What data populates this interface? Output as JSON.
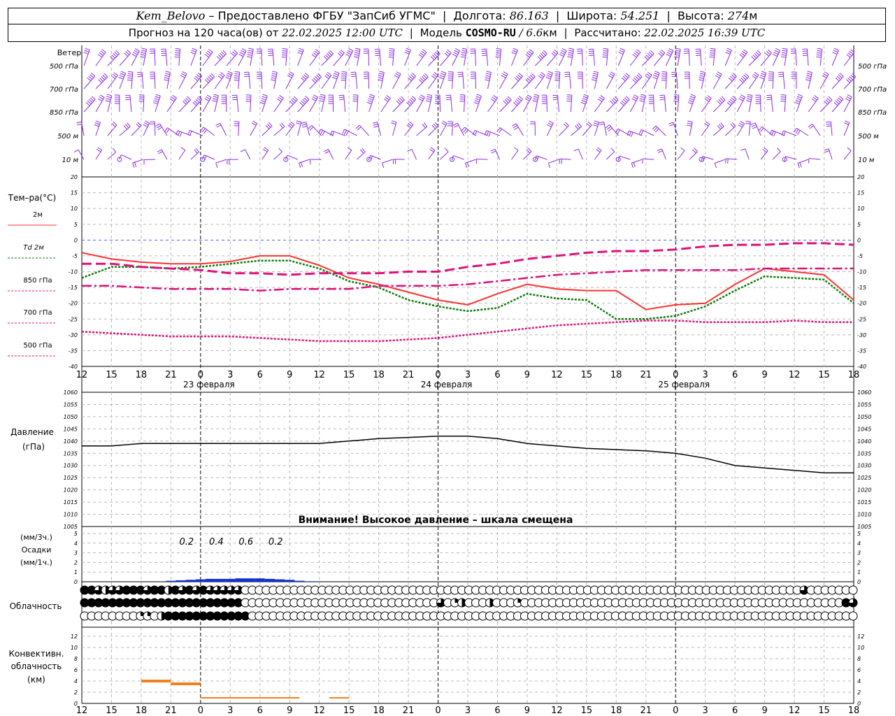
{
  "header": {
    "station": "Kem_Belovo",
    "provided_by": "– Предоставлено ФГБУ \"ЗапСиб УГМС\"",
    "lon_label": "Долгота:",
    "lon_value": "86.163",
    "lat_label": "Широта:",
    "lat_value": "54.251",
    "alt_label": "Высота:",
    "alt_value": "274",
    "alt_unit": "м",
    "forecast_prefix": "Прогноз на 120 часа(ов) от",
    "forecast_start": "22.02.2025 12:00 UTC",
    "model_label": "Модель",
    "model_name": "COSMO-RU",
    "model_res": "/ 6.6",
    "model_res_unit": "км",
    "calc_label": "Рассчитано:",
    "calc_time": "22.02.2025 16:39 UTC"
  },
  "time_axis": {
    "hour_labels": [
      "12",
      "15",
      "18",
      "21",
      "0",
      "3",
      "6",
      "9",
      "12",
      "15",
      "18",
      "21",
      "0",
      "3",
      "6",
      "9",
      "12",
      "15",
      "18",
      "21",
      "0",
      "3",
      "6",
      "9",
      "12",
      "15",
      "18"
    ],
    "day_labels": [
      "23 февраля",
      "24 февраля",
      "25 февраля"
    ]
  },
  "chart_data": [
    {
      "type": "wind_barbs",
      "title": "Ветер",
      "levels": [
        "500 гПа",
        "700 гПа",
        "850 гПа",
        "500 м",
        "10 м"
      ],
      "color": "#8a2be2"
    },
    {
      "type": "line",
      "ylabel": "Тем–ра(°С)",
      "ylim": [
        -40,
        20
      ],
      "yticks": [
        20,
        15,
        10,
        5,
        0,
        -5,
        -10,
        -15,
        -20,
        -25,
        -30,
        -35,
        -40
      ],
      "x_hours": [
        0,
        3,
        6,
        9,
        12,
        15,
        18,
        21,
        24,
        27,
        30,
        33,
        36,
        39,
        42,
        45,
        48,
        51,
        54,
        57,
        60,
        63,
        66,
        69,
        72,
        75,
        78
      ],
      "series": [
        {
          "name": "2м",
          "color": "#ff3030",
          "style": "solid",
          "values": [
            -4,
            -6,
            -7,
            -7.5,
            -7.5,
            -6.8,
            -5,
            -5,
            -8,
            -12,
            -14,
            -16.5,
            -19,
            -20.5,
            -17,
            -14,
            -15.5,
            -16,
            -16,
            -22,
            -20.5,
            -20,
            -14,
            -9,
            -10,
            -11,
            -19
          ]
        },
        {
          "name": "Td 2м",
          "color": "#0a7a0a",
          "style": "dotted",
          "values": [
            -12,
            -8.5,
            -8.5,
            -9,
            -8.5,
            -7.5,
            -6.5,
            -6.5,
            -9,
            -13,
            -15,
            -19,
            -21,
            -22.5,
            -21.5,
            -17,
            -18.5,
            -19,
            -25,
            -25,
            -24,
            -21,
            -16,
            -11.5,
            -12,
            -12.5,
            -20
          ]
        },
        {
          "name": "850 гПа",
          "color": "#e0107a",
          "style": "longdash",
          "values": [
            -7.5,
            -7.5,
            -8.5,
            -9,
            -9.5,
            -10.5,
            -10.5,
            -11,
            -10.5,
            -10.5,
            -10.5,
            -10,
            -10,
            -8.5,
            -7.5,
            -6,
            -5,
            -4,
            -3.5,
            -3.5,
            -3,
            -2,
            -1.5,
            -1.5,
            -1,
            -1,
            -1.5
          ]
        },
        {
          "name": "700 гПа",
          "color": "#e0107a",
          "style": "dashdot",
          "values": [
            -14.5,
            -14.5,
            -15,
            -15.5,
            -15.5,
            -15.5,
            -16,
            -15.5,
            -15.5,
            -15.5,
            -14.5,
            -14.5,
            -14.5,
            -14,
            -13,
            -12,
            -11,
            -10.5,
            -10,
            -9.5,
            -9.5,
            -9.5,
            -9.5,
            -9,
            -9,
            -9,
            -9
          ]
        },
        {
          "name": "500 гПа",
          "color": "#e0107a",
          "style": "dense",
          "values": [
            -29,
            -29.5,
            -30,
            -30.5,
            -30.5,
            -30.5,
            -31,
            -31.5,
            -32,
            -32,
            -32,
            -31.5,
            -31,
            -30,
            -29,
            -28,
            -27,
            -26.5,
            -26,
            -25.5,
            -25.5,
            -26,
            -26,
            -26,
            -25.5,
            -26,
            -26
          ]
        }
      ]
    },
    {
      "type": "line",
      "ylabel": "Давление",
      "yunit": "(гПа)",
      "ylim": [
        1005,
        1060
      ],
      "yticks": [
        1060,
        1055,
        1050,
        1045,
        1040,
        1035,
        1030,
        1025,
        1020,
        1015,
        1010,
        1005
      ],
      "annotation": "Внимание! Высокое давление – шкала смещена",
      "series": [
        {
          "name": "",
          "color": "#000000",
          "values": [
            1038,
            1038,
            1039,
            1039,
            1039,
            1039,
            1039,
            1039,
            1039,
            1040,
            1041,
            1041.5,
            1042,
            1042,
            1041,
            1039,
            1038,
            1037,
            1036.5,
            1036,
            1035,
            1033,
            1030,
            1029,
            1028,
            1027,
            1027
          ]
        }
      ]
    },
    {
      "type": "bar",
      "ylabel": "Осадки",
      "yunit_top": "(мм/3ч.)",
      "yunit_bottom": "(мм/1ч.)",
      "ylim": [
        0,
        5
      ],
      "yticks": [
        5,
        4,
        3,
        2,
        1,
        0
      ],
      "color": "#1030d0",
      "labels": [
        "0.2",
        "0.4",
        "0.6",
        "0.2"
      ],
      "label_hours": [
        12,
        15,
        18,
        21
      ],
      "hourly": [
        [
          9,
          0.1
        ],
        [
          10,
          0.15
        ],
        [
          11,
          0.2
        ],
        [
          12,
          0.25
        ],
        [
          13,
          0.3
        ],
        [
          14,
          0.3
        ],
        [
          15,
          0.3
        ],
        [
          16,
          0.35
        ],
        [
          17,
          0.35
        ],
        [
          18,
          0.35
        ],
        [
          19,
          0.3
        ],
        [
          20,
          0.25
        ],
        [
          21,
          0.2
        ],
        [
          22,
          0.1
        ],
        [
          23,
          0.05
        ]
      ]
    },
    {
      "type": "table",
      "ylabel": "Облачность",
      "rows_high": [
        4,
        4,
        3,
        2,
        3,
        3,
        4,
        4,
        4,
        3,
        4,
        4,
        2,
        4,
        3,
        4,
        3,
        4,
        3,
        3,
        3,
        3,
        3,
        0,
        0,
        0,
        0,
        0,
        0,
        0,
        0,
        0,
        0,
        0,
        0,
        0,
        0,
        0,
        0,
        0,
        0,
        0,
        0,
        0,
        0,
        0,
        0,
        0,
        0,
        0,
        0,
        0,
        0,
        0,
        0,
        0,
        0,
        0,
        0,
        0,
        0,
        0,
        0,
        0,
        0,
        0,
        0,
        0,
        0,
        0,
        0,
        0,
        0,
        0,
        0,
        0,
        0,
        0,
        0,
        0,
        0,
        0,
        0,
        0,
        0,
        0,
        0,
        0,
        0,
        0,
        0,
        0,
        0,
        0,
        0,
        0,
        0,
        0,
        0,
        0,
        0,
        0,
        0,
        3,
        0,
        0,
        0,
        0,
        0,
        0,
        0
      ],
      "rows_mid": [
        4,
        4,
        4,
        4,
        4,
        4,
        4,
        4,
        4,
        4,
        4,
        4,
        4,
        4,
        4,
        4,
        4,
        4,
        4,
        4,
        4,
        4,
        4,
        0,
        0,
        0,
        0,
        0,
        0,
        0,
        0,
        0,
        0,
        0,
        0,
        0,
        0,
        0,
        0,
        0,
        0,
        0,
        0,
        0,
        0,
        0,
        0,
        0,
        0,
        0,
        0,
        3,
        0,
        1,
        2,
        0,
        0,
        0,
        2,
        0,
        0,
        0,
        1,
        0,
        0,
        0,
        0,
        0,
        0,
        0,
        0,
        0,
        0,
        0,
        0,
        0,
        0,
        0,
        0,
        0,
        0,
        0,
        0,
        0,
        0,
        0,
        0,
        0,
        0,
        0,
        0,
        0,
        0,
        0,
        0,
        0,
        0,
        0,
        0,
        0,
        0,
        0,
        0,
        0,
        0,
        0,
        0,
        0,
        0,
        4,
        3
      ],
      "rows_low": [
        0,
        0,
        0,
        0,
        0,
        0,
        0,
        0,
        1,
        1,
        0,
        2,
        4,
        4,
        4,
        4,
        4,
        4,
        4,
        4,
        4,
        4,
        4,
        4,
        0,
        0,
        0,
        0,
        0,
        0,
        0,
        0,
        0,
        0,
        0,
        0,
        0,
        0,
        0,
        0,
        0,
        0,
        0,
        0,
        0,
        0,
        0,
        0,
        0,
        0,
        0,
        0,
        0,
        0,
        0,
        0,
        0,
        0,
        0,
        0,
        0,
        0,
        0,
        0,
        0,
        0,
        0,
        0,
        0,
        0,
        0,
        0,
        0,
        0,
        0,
        0,
        0,
        0,
        0,
        0,
        0,
        0,
        0,
        0,
        0,
        0,
        0,
        0,
        0,
        0,
        0,
        0,
        0,
        0,
        0,
        0,
        0,
        0,
        0,
        0,
        0,
        0,
        0,
        0,
        0,
        0,
        0,
        0,
        0,
        0,
        0
      ]
    },
    {
      "type": "bar",
      "ylabel": "Конвективн. облачность",
      "yunit": "(км)",
      "ylim": [
        0,
        14
      ],
      "yticks": [
        12,
        10,
        8,
        6,
        4,
        2,
        0
      ],
      "color": "#f08020",
      "segments": [
        [
          6,
          9,
          4
        ],
        [
          9,
          12,
          3.5
        ],
        [
          12,
          22,
          1
        ],
        [
          25,
          27,
          1
        ]
      ]
    }
  ]
}
